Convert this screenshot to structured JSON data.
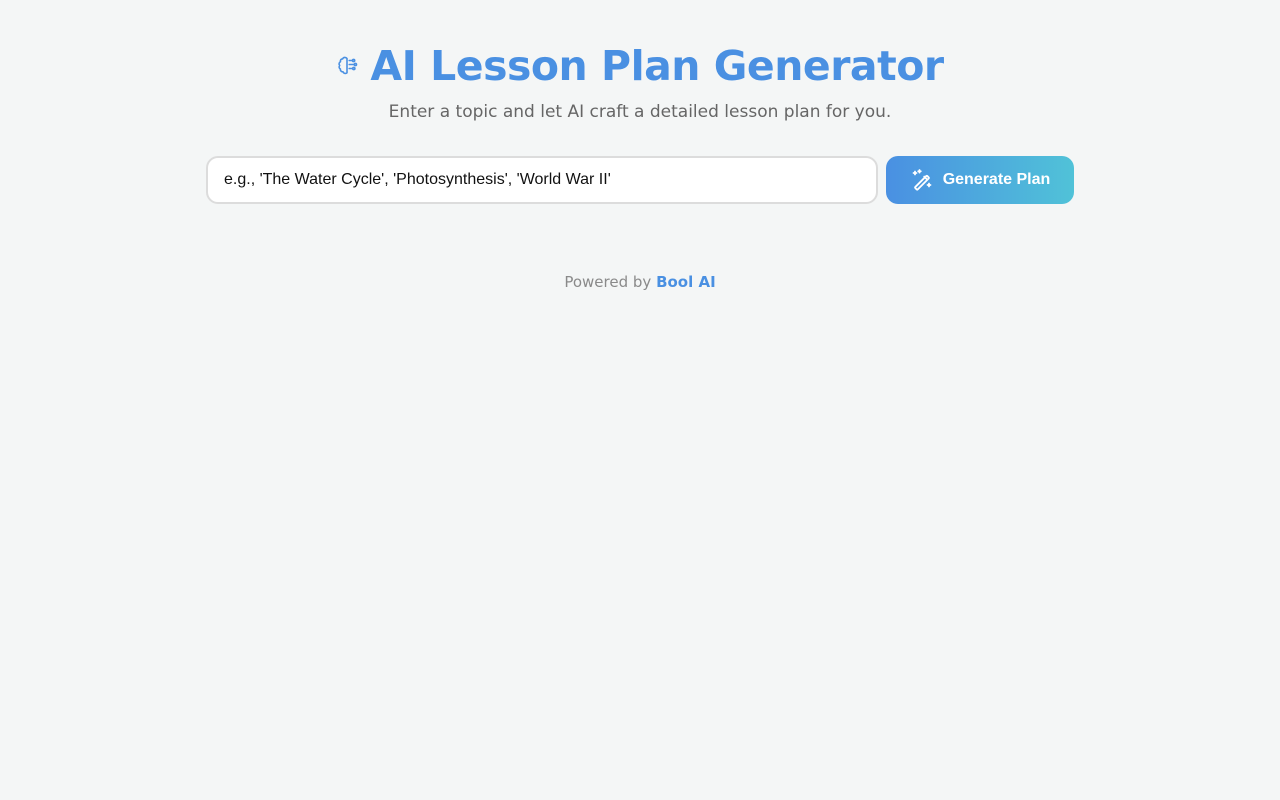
{
  "header": {
    "title": "AI Lesson Plan Generator",
    "subtitle": "Enter a topic and let AI craft a detailed lesson plan for you.",
    "icon": "brain-icon"
  },
  "form": {
    "topic_placeholder": "e.g., 'The Water Cycle', 'Photosynthesis', 'World War II'",
    "topic_value": "",
    "generate_label": "Generate Plan",
    "generate_icon": "magic-wand-icon"
  },
  "footer": {
    "prefix": "Powered by",
    "brand": "Bool AI"
  },
  "colors": {
    "accent": "#4a90e2",
    "gradient_end": "#50c2d8",
    "background": "#f4f6f6",
    "subtitle": "#666666",
    "footer_text": "#8a8a8a"
  }
}
